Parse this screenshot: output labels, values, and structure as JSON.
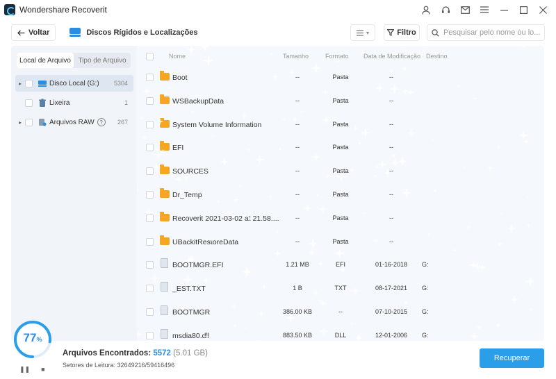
{
  "app": {
    "title": "Wondershare Recoverit",
    "window_controls": [
      "person-icon",
      "headset-icon",
      "mail-icon",
      "menu-icon",
      "minimize-icon",
      "maximize-icon",
      "close-icon"
    ]
  },
  "toolbar": {
    "back_label": "Voltar",
    "location_label": "Discos Rígidos e Localizações",
    "filter_label": "Filtro",
    "search_placeholder": "Pesquisar pelo nome ou lo..."
  },
  "sidebar": {
    "tabs": [
      {
        "label": "Local de Arquivo",
        "active": true
      },
      {
        "label": "Tipo de Arquivo",
        "active": false
      }
    ],
    "items": [
      {
        "label": "Disco Local (G:)",
        "count": "5304",
        "expandable": true,
        "icon": "disk-icon",
        "selected": true
      },
      {
        "label": "Lixeira",
        "count": "1",
        "expandable": false,
        "icon": "trash-icon",
        "selected": false
      },
      {
        "label": "Arquivos RAW",
        "count": "267",
        "expandable": true,
        "icon": "raw-files-icon",
        "selected": false
      }
    ]
  },
  "table": {
    "headers": {
      "name": "Nome",
      "size": "Tamanho",
      "format": "Formato",
      "date": "Data de Modificação",
      "dest": "Destino"
    },
    "rows": [
      {
        "type": "folder",
        "name": "Boot",
        "size": "--",
        "format": "Pasta",
        "date": "--",
        "dest": ""
      },
      {
        "type": "folder",
        "name": "WSBackupData",
        "size": "--",
        "format": "Pasta",
        "date": "--",
        "dest": ""
      },
      {
        "type": "folder",
        "name": "System Volume Information",
        "size": "--",
        "format": "Pasta",
        "date": "--",
        "dest": ""
      },
      {
        "type": "folder",
        "name": "EFI",
        "size": "--",
        "format": "Pasta",
        "date": "--",
        "dest": ""
      },
      {
        "type": "folder",
        "name": "SOURCES",
        "size": "--",
        "format": "Pasta",
        "date": "--",
        "dest": ""
      },
      {
        "type": "folder",
        "name": "Dr_Temp",
        "size": "--",
        "format": "Pasta",
        "date": "--",
        "dest": ""
      },
      {
        "type": "folder",
        "name": "Recoverit 2021-03-02 at 21.58....",
        "size": "--",
        "format": "Pasta",
        "date": "--",
        "dest": ""
      },
      {
        "type": "folder",
        "name": "UBackitRestoreData",
        "size": "--",
        "format": "Pasta",
        "date": "--",
        "dest": ""
      },
      {
        "type": "file",
        "name": "BOOTMGR.EFI",
        "size": "1.21 MB",
        "format": "EFI",
        "date": "01-16-2018",
        "dest": "G:"
      },
      {
        "type": "file",
        "name": "_EST.TXT",
        "size": "1 B",
        "format": "TXT",
        "date": "08-17-2021",
        "dest": "G:"
      },
      {
        "type": "file",
        "name": "BOOTMGR",
        "size": "386.00 KB",
        "format": "--",
        "date": "07-10-2015",
        "dest": "G:"
      },
      {
        "type": "file",
        "name": "msdia80.dll",
        "size": "883.50 KB",
        "format": "DLL",
        "date": "12-01-2006",
        "dest": "G:"
      }
    ]
  },
  "footer": {
    "progress_percent": 77,
    "progress_value": "77",
    "progress_unit": "%",
    "found_label": "Arquivos Encontrados:",
    "found_count": "5572",
    "found_size": "(5.01 GB)",
    "sectors": "Setores de Leitura: 32649216/59416496",
    "recover_label": "Recuperar"
  },
  "colors": {
    "accent": "#2b8de0",
    "recover_button": "#2b9eea",
    "folder": "#f5a623",
    "panel_bg": "#f1f4f8"
  }
}
